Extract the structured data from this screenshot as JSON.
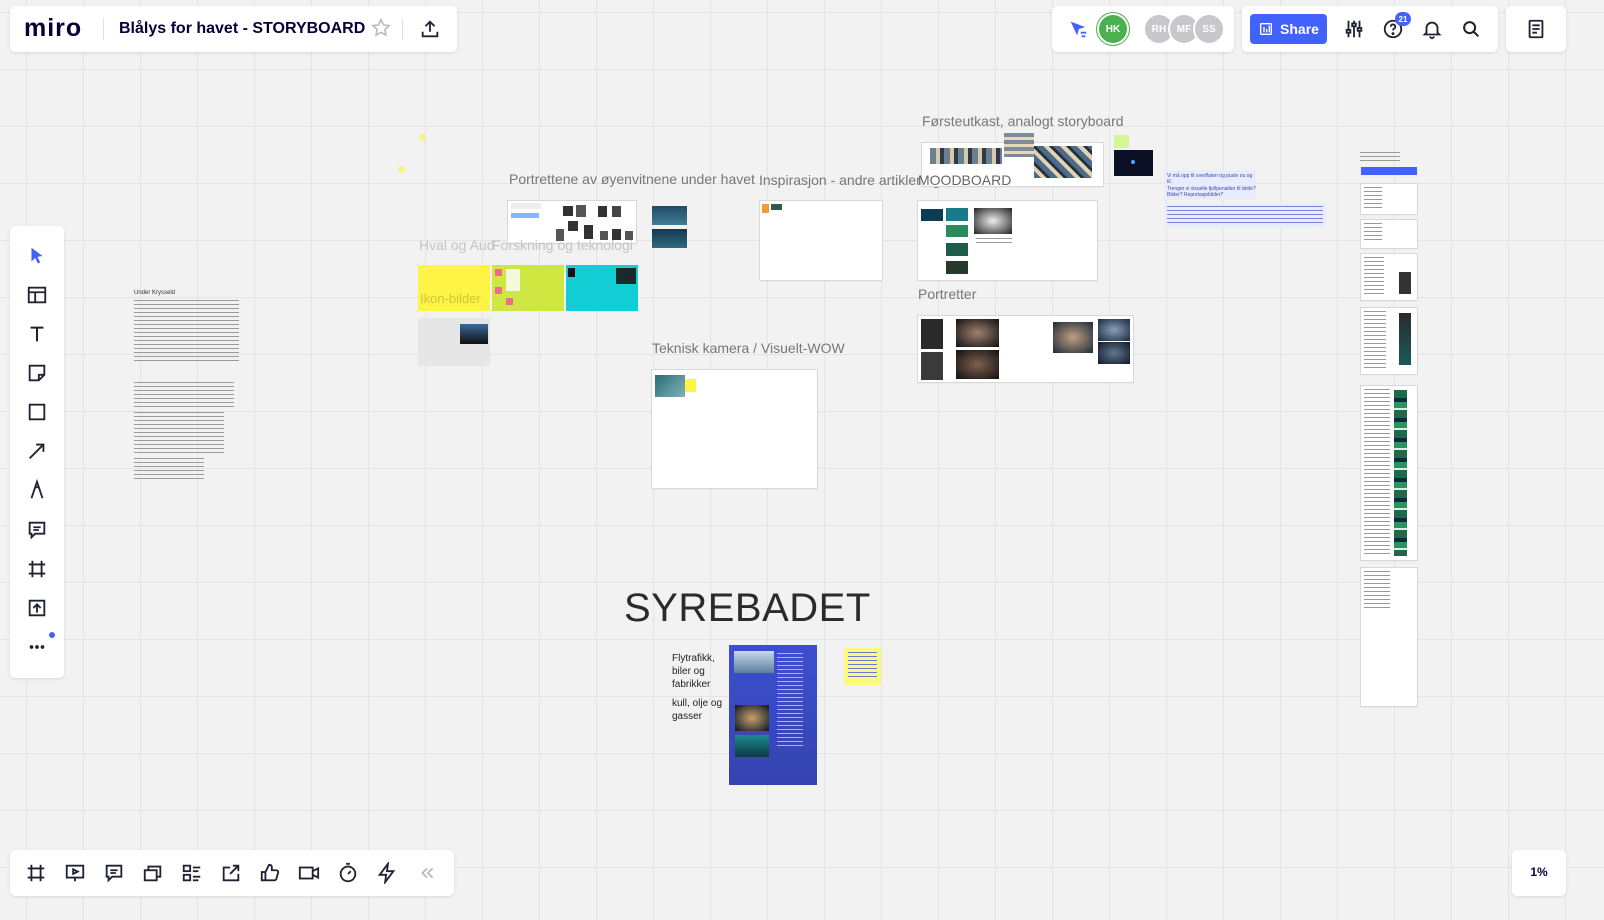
{
  "app": {
    "logo": "miro"
  },
  "board": {
    "title": "Blålys for havet - STORYBOARD"
  },
  "header": {
    "avatars": [
      {
        "initials": "HK",
        "color": "#4caf50"
      },
      {
        "initials": "RH",
        "color": "#c7c7cc"
      },
      {
        "initials": "MF",
        "color": "#c7c7cc"
      },
      {
        "initials": "SS",
        "color": "#c7c7cc"
      }
    ],
    "share_label": "Share",
    "help_badge": "21",
    "accent": "#4262ff"
  },
  "toolbar_left": {
    "tools": [
      "select-icon",
      "templates-icon",
      "text-icon",
      "sticky-note-icon",
      "shape-icon",
      "arrow-icon",
      "pen-icon",
      "comment-icon",
      "frame-icon",
      "upload-icon",
      "more-icon"
    ]
  },
  "toolbar_bottom": {
    "tools": [
      "frames-icon",
      "presentation-icon",
      "comments-icon",
      "cards-icon",
      "kanban-icon",
      "share-screen-icon",
      "voting-icon",
      "video-icon",
      "timer-icon",
      "lightning-icon",
      "collapse-icon"
    ],
    "zoom": "1%"
  },
  "canvas": {
    "frames": {
      "forsteutkast": "Førsteutkast, analogt storyboard",
      "portrettene": "Portrettene av øyenvitnene under havet",
      "inspirasjon": "Inspirasjon - andre artikler og lenker",
      "moodboard": "MOODBOARD",
      "hval": "Hval og Aud",
      "forsk": "Forskning og teknologi",
      "ikon": "Ikon-bilder",
      "teknisk": "Teknisk kamera / Visuelt-WOW",
      "portretter": "Portretter"
    },
    "syrebadet": {
      "title": "SYREBADET",
      "note1": "Flytrafikk, biler og fabrikker",
      "note2": "kull, olje og gasser"
    },
    "document": {
      "title": "Under Krysseld"
    },
    "side_notes": {
      "q1": "Vi må opp til overflaten og puste ou og til.",
      "q2": "Trenger vi visuelle fjellpenaliter til dette? Bilder? Reportasjebilder?"
    }
  }
}
